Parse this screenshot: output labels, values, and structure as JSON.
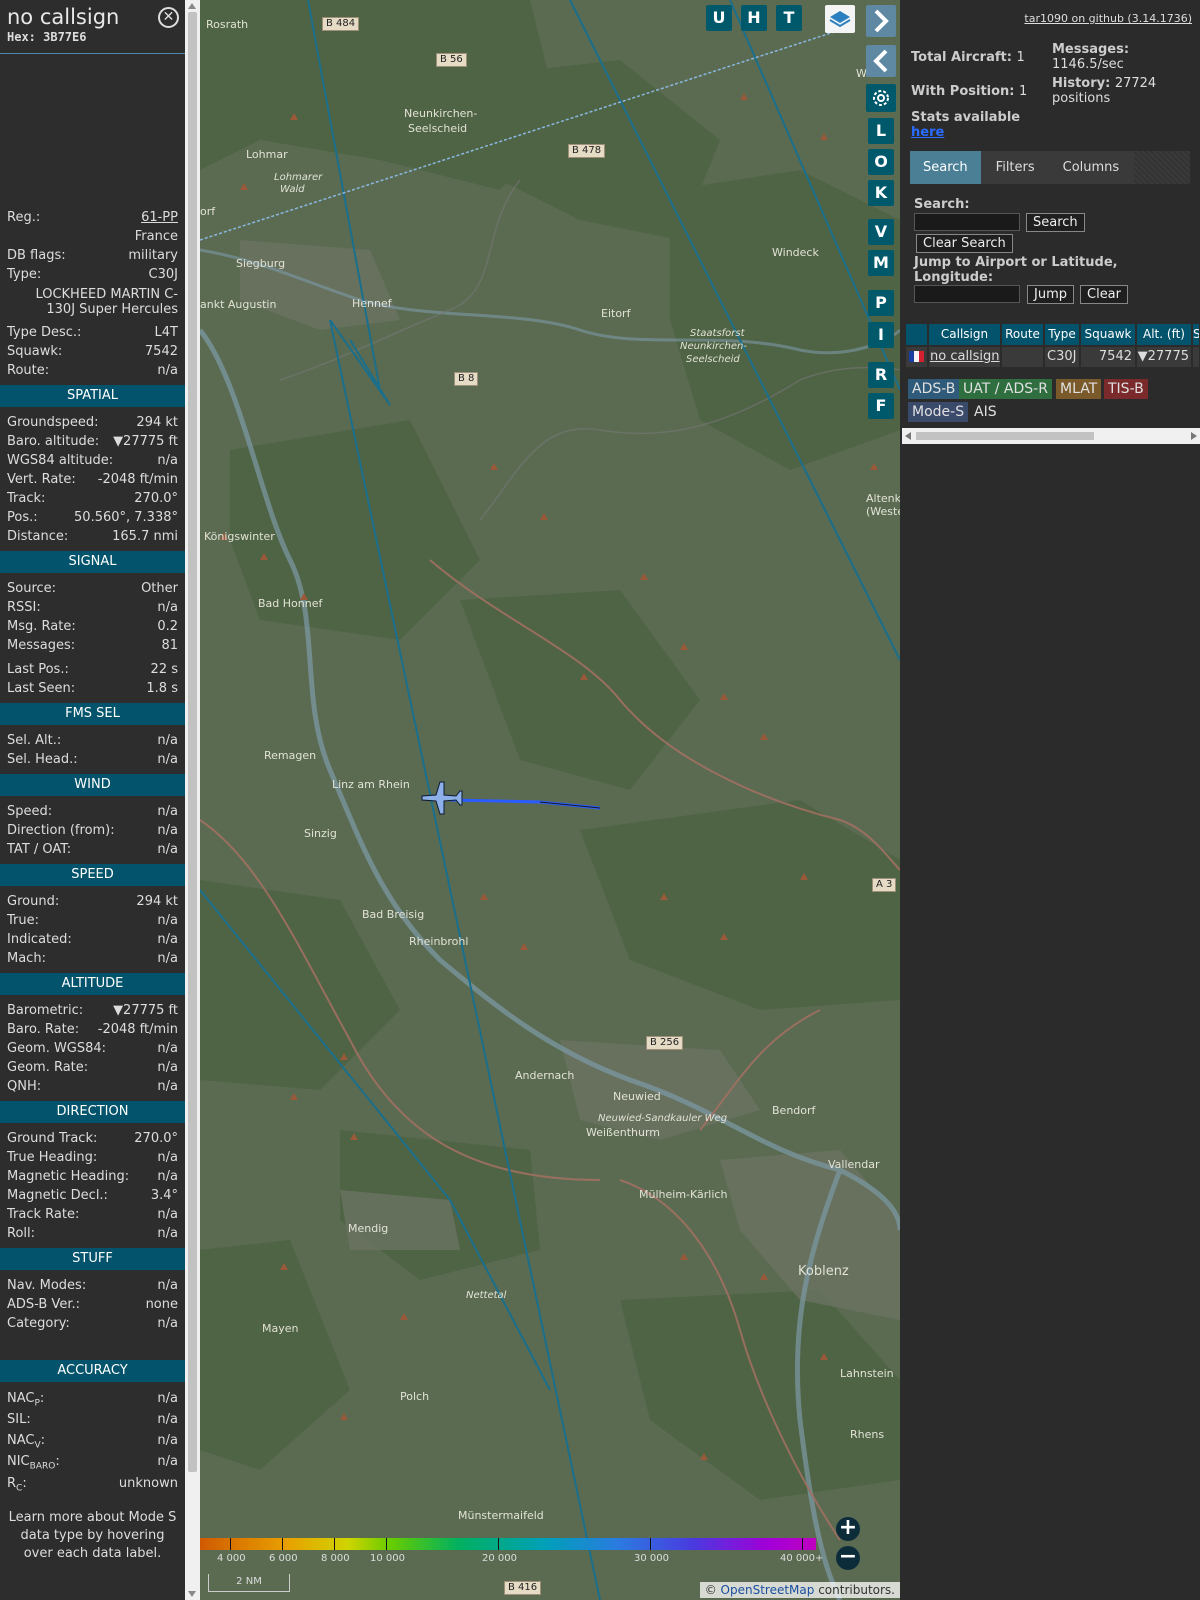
{
  "info": {
    "callsign": "no callsign",
    "hex": "Hex: 3B77E6",
    "reg_label": "Reg.:",
    "reg": "61-PP",
    "country": "France",
    "dbflags_label": "DB flags:",
    "dbflags": "military",
    "type_label": "Type:",
    "type": "C30J",
    "type_full": "LOCKHEED MARTIN C-130J Super Hercules",
    "typedesc_label": "Type Desc.:",
    "typedesc": "L4T",
    "squawk_label": "Squawk:",
    "squawk": "7542",
    "route_label": "Route:",
    "route": "n/a",
    "spatial": {
      "title": "SPATIAL",
      "rows": [
        {
          "k": "Groundspeed:",
          "v": "294 kt"
        },
        {
          "k": "Baro. altitude:",
          "v": "▼27775 ft"
        },
        {
          "k": "WGS84 altitude:",
          "v": "n/a"
        },
        {
          "k": "Vert. Rate:",
          "v": "-2048 ft/min"
        },
        {
          "k": "Track:",
          "v": "270.0°"
        },
        {
          "k": "Pos.:",
          "v": "50.560°, 7.338°"
        },
        {
          "k": "Distance:",
          "v": "165.7 nmi"
        }
      ]
    },
    "signal": {
      "title": "SIGNAL",
      "rows": [
        {
          "k": "Source:",
          "v": "Other"
        },
        {
          "k": "RSSI:",
          "v": "n/a"
        },
        {
          "k": "Msg. Rate:",
          "v": "0.2"
        },
        {
          "k": "Messages:",
          "v": "81"
        },
        {
          "k": "Last Pos.:",
          "v": "22 s"
        },
        {
          "k": "Last Seen:",
          "v": "1.8 s"
        }
      ]
    },
    "fms": {
      "title": "FMS SEL",
      "rows": [
        {
          "k": "Sel. Alt.:",
          "v": "n/a"
        },
        {
          "k": "Sel. Head.:",
          "v": "n/a"
        }
      ]
    },
    "wind": {
      "title": "WIND",
      "rows": [
        {
          "k": "Speed:",
          "v": "n/a"
        },
        {
          "k": "Direction (from):",
          "v": "n/a"
        },
        {
          "k": "TAT / OAT:",
          "v": "n/a"
        }
      ]
    },
    "speed": {
      "title": "SPEED",
      "rows": [
        {
          "k": "Ground:",
          "v": "294 kt"
        },
        {
          "k": "True:",
          "v": "n/a"
        },
        {
          "k": "Indicated:",
          "v": "n/a"
        },
        {
          "k": "Mach:",
          "v": "n/a"
        }
      ]
    },
    "altitude": {
      "title": "ALTITUDE",
      "rows": [
        {
          "k": "Barometric:",
          "v": "▼27775 ft"
        },
        {
          "k": "Baro. Rate:",
          "v": "-2048 ft/min"
        },
        {
          "k": "Geom. WGS84:",
          "v": "n/a"
        },
        {
          "k": "Geom. Rate:",
          "v": "n/a"
        },
        {
          "k": "QNH:",
          "v": "n/a"
        }
      ]
    },
    "direction": {
      "title": "DIRECTION",
      "rows": [
        {
          "k": "Ground Track:",
          "v": "270.0°"
        },
        {
          "k": "True Heading:",
          "v": "n/a"
        },
        {
          "k": "Magnetic Heading:",
          "v": "n/a"
        },
        {
          "k": "Magnetic Decl.:",
          "v": "3.4°"
        },
        {
          "k": "Track Rate:",
          "v": "n/a"
        },
        {
          "k": "Roll:",
          "v": "n/a"
        }
      ]
    },
    "stuff": {
      "title": "STUFF",
      "rows": [
        {
          "k": "Nav. Modes:",
          "v": "n/a"
        },
        {
          "k": "ADS-B Ver.:",
          "v": "none"
        },
        {
          "k": "Category:",
          "v": "n/a"
        }
      ]
    },
    "accuracy": {
      "title": "ACCURACY",
      "nacp": {
        "base": "NAC",
        "sub": "P",
        "v": "n/a"
      },
      "sil": {
        "k": "SIL:",
        "v": "n/a"
      },
      "nacv": {
        "base": "NAC",
        "sub": "V",
        "v": "n/a"
      },
      "nicbaro": {
        "base": "NIC",
        "sub": "BARO",
        "v": "n/a"
      },
      "rc": {
        "base": "R",
        "sub": "C",
        "v": "unknown"
      }
    },
    "footer": "Learn more about Mode S data type by hovering over each data label."
  },
  "map": {
    "places": [
      {
        "t": "Rosrath"
      },
      {
        "t": "Neunkirchen-"
      },
      {
        "t": "Seelscheid"
      },
      {
        "t": "Lohmar"
      },
      {
        "t": "Lohmarer"
      },
      {
        "t": "Wald"
      },
      {
        "t": "Siegburg"
      },
      {
        "t": "ankt Augustin"
      },
      {
        "t": "Hennef"
      },
      {
        "t": "Eitorf"
      },
      {
        "t": "Windeck"
      },
      {
        "t": "Staatsforst"
      },
      {
        "t": "Neunkirchen-"
      },
      {
        "t": "Seelscheid"
      },
      {
        "t": "Königswinter"
      },
      {
        "t": "Bad Honnef"
      },
      {
        "t": "Remagen"
      },
      {
        "t": "Linz am Rhein"
      },
      {
        "t": "Sinzig"
      },
      {
        "t": "Bad Breisig"
      },
      {
        "t": "Rheinbrohl"
      },
      {
        "t": "Andernach"
      },
      {
        "t": "Neuwied"
      },
      {
        "t": "Weißenthurm"
      },
      {
        "t": "Bendorf"
      },
      {
        "t": "Vallendar"
      },
      {
        "t": "Mülheim-Kärlich"
      },
      {
        "t": "Koblenz"
      },
      {
        "t": "Mendig"
      },
      {
        "t": "Mayen"
      },
      {
        "t": "Polch"
      },
      {
        "t": "Münstermaifeld"
      },
      {
        "t": "Lahnstein"
      },
      {
        "t": "Rhens"
      },
      {
        "t": "Waldbr"
      },
      {
        "t": "Altenk"
      },
      {
        "t": "(Weste"
      },
      {
        "t": "Nettetal"
      },
      {
        "t": "Neuwied-Sandkauler Weg"
      },
      {
        "t": "orf"
      }
    ],
    "roads": [
      {
        "t": "B 484"
      },
      {
        "t": "B 56"
      },
      {
        "t": "B 478"
      },
      {
        "t": "B 8"
      },
      {
        "t": "B 256"
      },
      {
        "t": "A 3"
      },
      {
        "t": "B 416"
      }
    ],
    "buttons": {
      "u": "U",
      "h": "H",
      "t": "T",
      "l": "L",
      "o": "O",
      "k": "K",
      "v": "V",
      "m": "M",
      "p": "P",
      "i": "I",
      "r": "R",
      "f": "F"
    },
    "zoom_in": "+",
    "zoom_out": "−",
    "scale": "2 NM",
    "attribution_prefix": "© ",
    "attribution_link": "OpenStreetMap",
    "attribution_suffix": " contributors.",
    "alt_labels": [
      "4 000",
      "6 000",
      "8 000",
      "10 000",
      "20 000",
      "30 000",
      "40 000+"
    ],
    "colors": {
      "accent": "#00596b",
      "section": "#02536b",
      "track": "#2b5cff"
    }
  },
  "right": {
    "github": "tar1090 on github (3.14.1736)",
    "total_label": "Total Aircraft:",
    "total": "1",
    "withpos_label": "With Position:",
    "withpos": "1",
    "messages_label": "Messages:",
    "messages": "1146.5/sec",
    "history_label": "History:",
    "history": "27724",
    "history_unit": "positions",
    "stats_label": "Stats available",
    "stats_link": "here",
    "tabs": [
      "Search",
      "Filters",
      "Columns"
    ],
    "search_label": "Search:",
    "search_btn": "Search",
    "clear_search_btn": "Clear Search",
    "jump_label": "Jump to Airport or Latitude, Longitude:",
    "jump_btn": "Jump",
    "clear_btn": "Clear",
    "table": {
      "headers": [
        "Callsign",
        "Route",
        "Type",
        "Squawk",
        "Alt. (ft)",
        "S"
      ],
      "row": {
        "callsign": "no callsign",
        "route": "",
        "type": "C30J",
        "squawk": "7542",
        "alt": "▼27775"
      }
    },
    "legend": [
      "ADS-B",
      "UAT / ADS-R",
      "MLAT",
      "TIS-B",
      "Mode-S",
      "AIS"
    ]
  }
}
